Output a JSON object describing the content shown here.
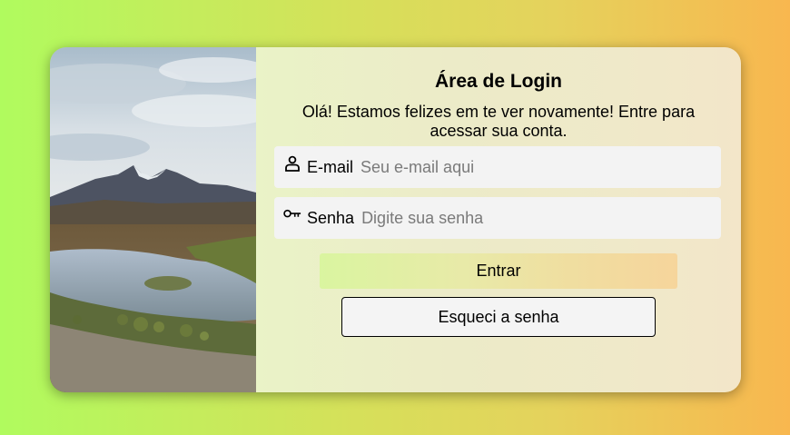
{
  "login": {
    "title": "Área de Login",
    "subtitle": "Olá! Estamos felizes em te ver novamente! Entre para acessar sua conta.",
    "email": {
      "icon": "person-icon",
      "label": "E-mail",
      "placeholder": "Seu e-mail aqui",
      "value": ""
    },
    "password": {
      "icon": "key-icon",
      "label": "Senha",
      "placeholder": "Digite sua senha",
      "value": ""
    },
    "submit_label": "Entrar",
    "forgot_label": "Esqueci a senha"
  },
  "image": {
    "subject": "mountain-landscape-photo"
  },
  "colors": {
    "background_left": "#b0fb5e",
    "background_right": "#f8b74f",
    "field_background": "#f3f3f3"
  }
}
